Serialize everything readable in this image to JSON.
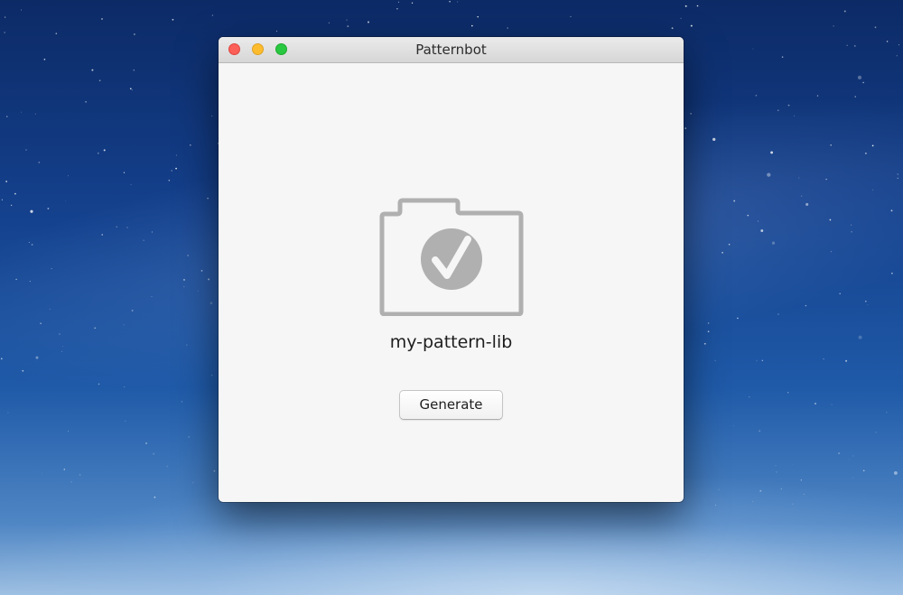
{
  "window": {
    "title": "Patternbot"
  },
  "main": {
    "folder_icon": "folder-check-icon",
    "folder_name": "my-pattern-lib",
    "generate_label": "Generate"
  },
  "colors": {
    "icon_gray": "#b0b0b0",
    "close": "#fc5f57",
    "minimize": "#fdbc2e",
    "maximize": "#28c840"
  }
}
